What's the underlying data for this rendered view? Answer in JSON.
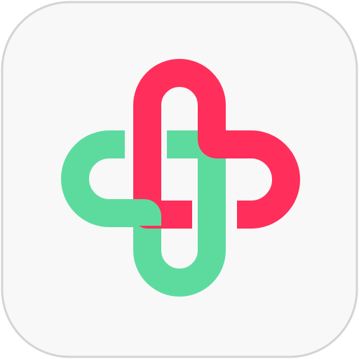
{
  "icon": {
    "name": "interlocking-cross-logo",
    "colors": {
      "tile_fill": "#f8f8f8",
      "tile_border": "#d4d4d4",
      "green": "#5ddb9f",
      "red": "#ff2e5b"
    }
  }
}
